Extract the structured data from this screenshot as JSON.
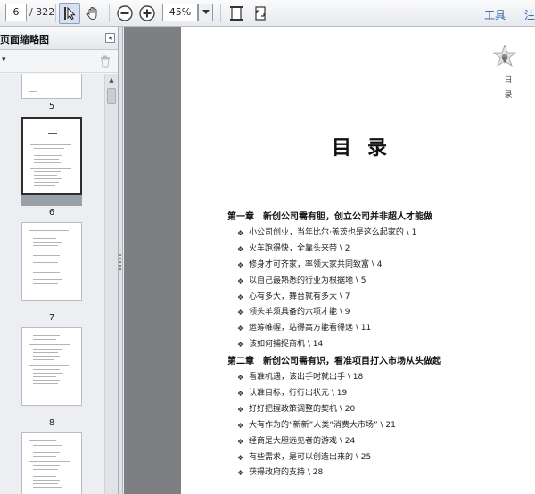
{
  "toolbar": {
    "current_page": "6",
    "page_total": "/ 322",
    "zoom": "45%",
    "tools_label": "工具",
    "comment_label": "注"
  },
  "sidebar": {
    "title": "页面缩略图",
    "collapse_glyph": "◂",
    "options_glyph": "▾",
    "thumbnails": [
      {
        "label": "5",
        "selected": false
      },
      {
        "label": "6",
        "selected": true
      },
      {
        "label": "7",
        "selected": false
      },
      {
        "label": "8",
        "selected": false
      }
    ]
  },
  "document": {
    "vertical_label": [
      "目",
      "录"
    ],
    "title": "目录",
    "chapters": [
      {
        "title": "第一章　新创公司需有胆，创立公司并非超人才能做",
        "entries": [
          "小公司创业，当年比尔·盖茨也是这么起家的 \\ 1",
          "火车跑得快，全靠头来带 \\ 2",
          "修身才可齐家，率领大家共同致富 \\ 4",
          "以自己最熟悉的行业为根据地 \\ 5",
          "心有多大，舞台就有多大 \\ 7",
          "领头羊须具备的六项才能 \\ 9",
          "运筹帷幄，站得高方能看得远 \\ 11",
          "该如何捕捉商机 \\ 14"
        ]
      },
      {
        "title": "第二章　新创公司需有识，看准项目打入市场从头做起",
        "entries": [
          "看准机遇，该出手时就出手 \\ 18",
          "认准目标，行行出状元 \\ 19",
          "好好把握政策调整的契机 \\ 20",
          "大有作为的“新新”人类“消费大市场” \\ 21",
          "经商是大胆远见者的游戏 \\ 24",
          "有些需求，是可以创造出来的 \\ 25",
          "获得政府的支持 \\ 28"
        ]
      }
    ]
  }
}
